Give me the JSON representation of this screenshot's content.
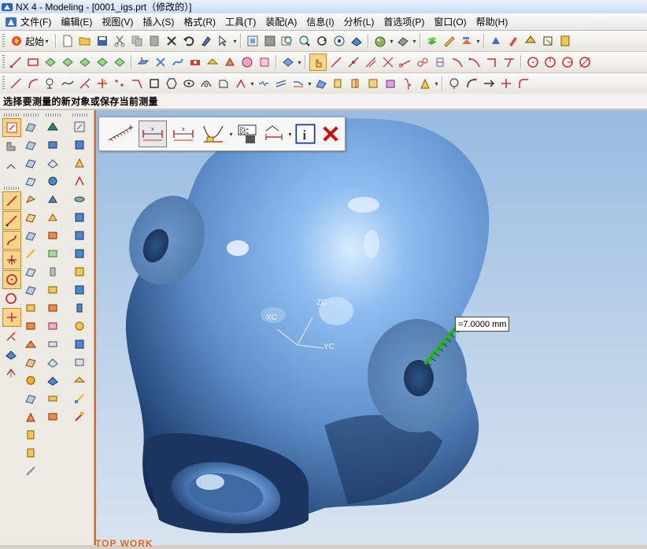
{
  "window": {
    "title": "NX 4 - Modeling - [0001_igs.prt（修改的）]"
  },
  "menu": {
    "items": [
      {
        "label": "文件(F)"
      },
      {
        "label": "编辑(E)"
      },
      {
        "label": "视图(V)"
      },
      {
        "label": "插入(S)"
      },
      {
        "label": "格式(R)"
      },
      {
        "label": "工具(T)"
      },
      {
        "label": "装配(A)"
      },
      {
        "label": "信息(I)"
      },
      {
        "label": "分析(L)"
      },
      {
        "label": "首选项(P)"
      },
      {
        "label": "窗口(O)"
      },
      {
        "label": "帮助(H)"
      }
    ]
  },
  "toolbar": {
    "start_label": "起始"
  },
  "status": {
    "prompt": "选择要测量的新对象或保存当前测量"
  },
  "measure": {
    "value_label": "=7.0000 mm"
  },
  "wcs": {
    "xc": "XC",
    "yc": "YC",
    "zc": "ZC"
  },
  "view": {
    "name": "TOP WORK"
  },
  "colors": {
    "viewport_top": "#98bbe0",
    "model_blue": "#6f9fd8",
    "measure_green": "#2bb02b",
    "accent_orange": "#e06a1c"
  }
}
